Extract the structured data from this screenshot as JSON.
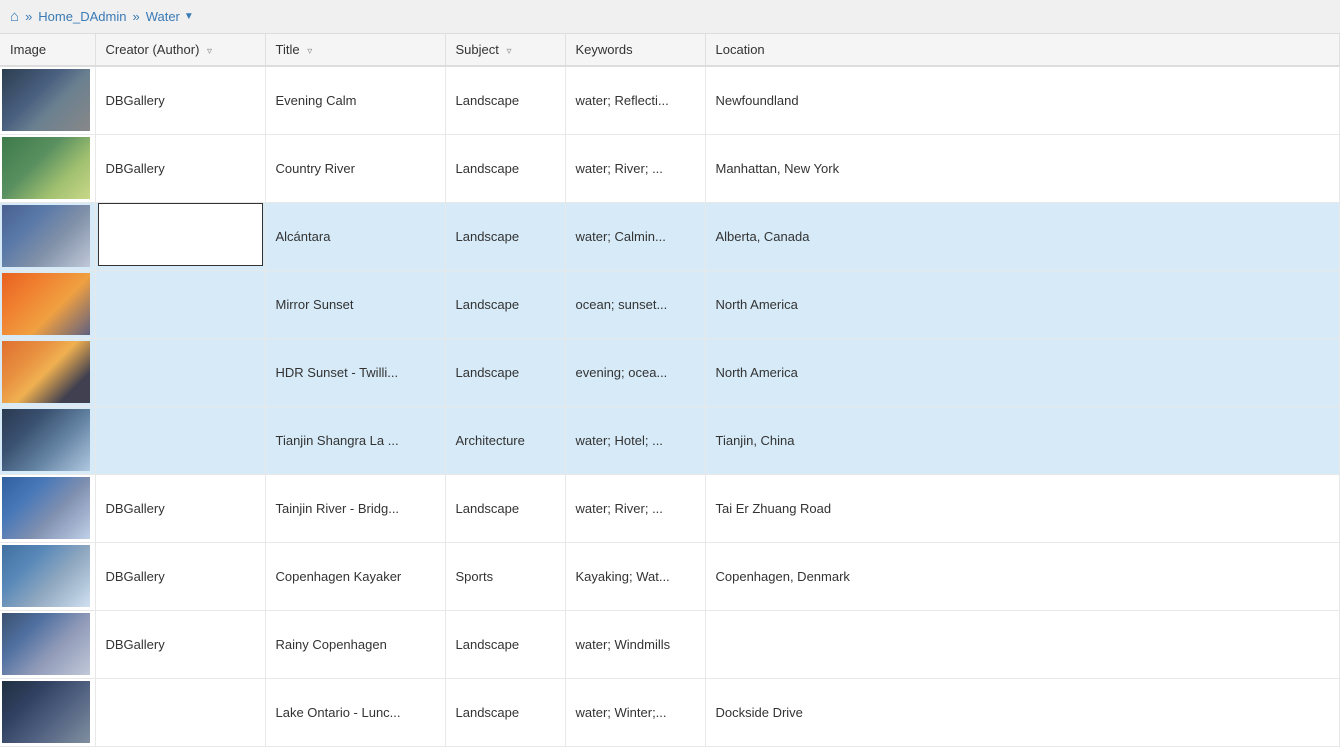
{
  "breadcrumb": {
    "home_label": "Home_DAdmin",
    "current": "Water"
  },
  "table": {
    "columns": [
      {
        "key": "image",
        "label": "Image",
        "sortable": false
      },
      {
        "key": "creator",
        "label": "Creator (Author)",
        "sortable": true
      },
      {
        "key": "title",
        "label": "Title",
        "sortable": true
      },
      {
        "key": "subject",
        "label": "Subject",
        "sortable": true
      },
      {
        "key": "keywords",
        "label": "Keywords",
        "sortable": false
      },
      {
        "key": "location",
        "label": "Location",
        "sortable": false
      }
    ],
    "rows": [
      {
        "id": 1,
        "creator": "DBGallery",
        "title": "Evening Calm",
        "subject": "Landscape",
        "keywords": "water; Reflecti...",
        "location": "Newfoundland",
        "thumb": "thumb-1",
        "editing": false
      },
      {
        "id": 2,
        "creator": "DBGallery",
        "title": "Country River",
        "subject": "Landscape",
        "keywords": "water; River; ...",
        "location": "Manhattan, New York",
        "thumb": "thumb-2",
        "editing": false
      },
      {
        "id": 3,
        "creator": "",
        "title": "Alcántara",
        "subject": "Landscape",
        "keywords": "water; Calmin...",
        "location": "Alberta, Canada",
        "thumb": "thumb-3",
        "editing": true,
        "selected": true
      },
      {
        "id": 4,
        "creator": "",
        "title": "Mirror Sunset",
        "subject": "Landscape",
        "keywords": "ocean; sunset...",
        "location": "North America",
        "thumb": "thumb-4",
        "editing": false,
        "selected": true
      },
      {
        "id": 5,
        "creator": "",
        "title": "HDR Sunset - Twilli...",
        "subject": "Landscape",
        "keywords": "evening; ocea...",
        "location": "North America",
        "thumb": "thumb-5",
        "editing": false,
        "selected": true
      },
      {
        "id": 6,
        "creator": "",
        "title": "Tianjin Shangra La ...",
        "subject": "Architecture",
        "keywords": "water; Hotel; ...",
        "location": "Tianjin, China",
        "thumb": "thumb-6",
        "editing": false,
        "selected": true
      },
      {
        "id": 7,
        "creator": "DBGallery",
        "title": "Tainjin River - Bridg...",
        "subject": "Landscape",
        "keywords": "water; River; ...",
        "location": "Tai Er Zhuang Road",
        "thumb": "thumb-7",
        "editing": false
      },
      {
        "id": 8,
        "creator": "DBGallery",
        "title": "Copenhagen Kayaker",
        "subject": "Sports",
        "keywords": "Kayaking; Wat...",
        "location": "Copenhagen, Denmark",
        "thumb": "thumb-8",
        "editing": false
      },
      {
        "id": 9,
        "creator": "DBGallery",
        "title": "Rainy Copenhagen",
        "subject": "Landscape",
        "keywords": "water; Windmills",
        "location": "",
        "thumb": "thumb-9",
        "editing": false
      },
      {
        "id": 10,
        "creator": "",
        "title": "Lake Ontario - Lunc...",
        "subject": "Landscape",
        "keywords": "water; Winter;...",
        "location": "Dockside Drive",
        "thumb": "thumb-10",
        "editing": false
      }
    ]
  }
}
